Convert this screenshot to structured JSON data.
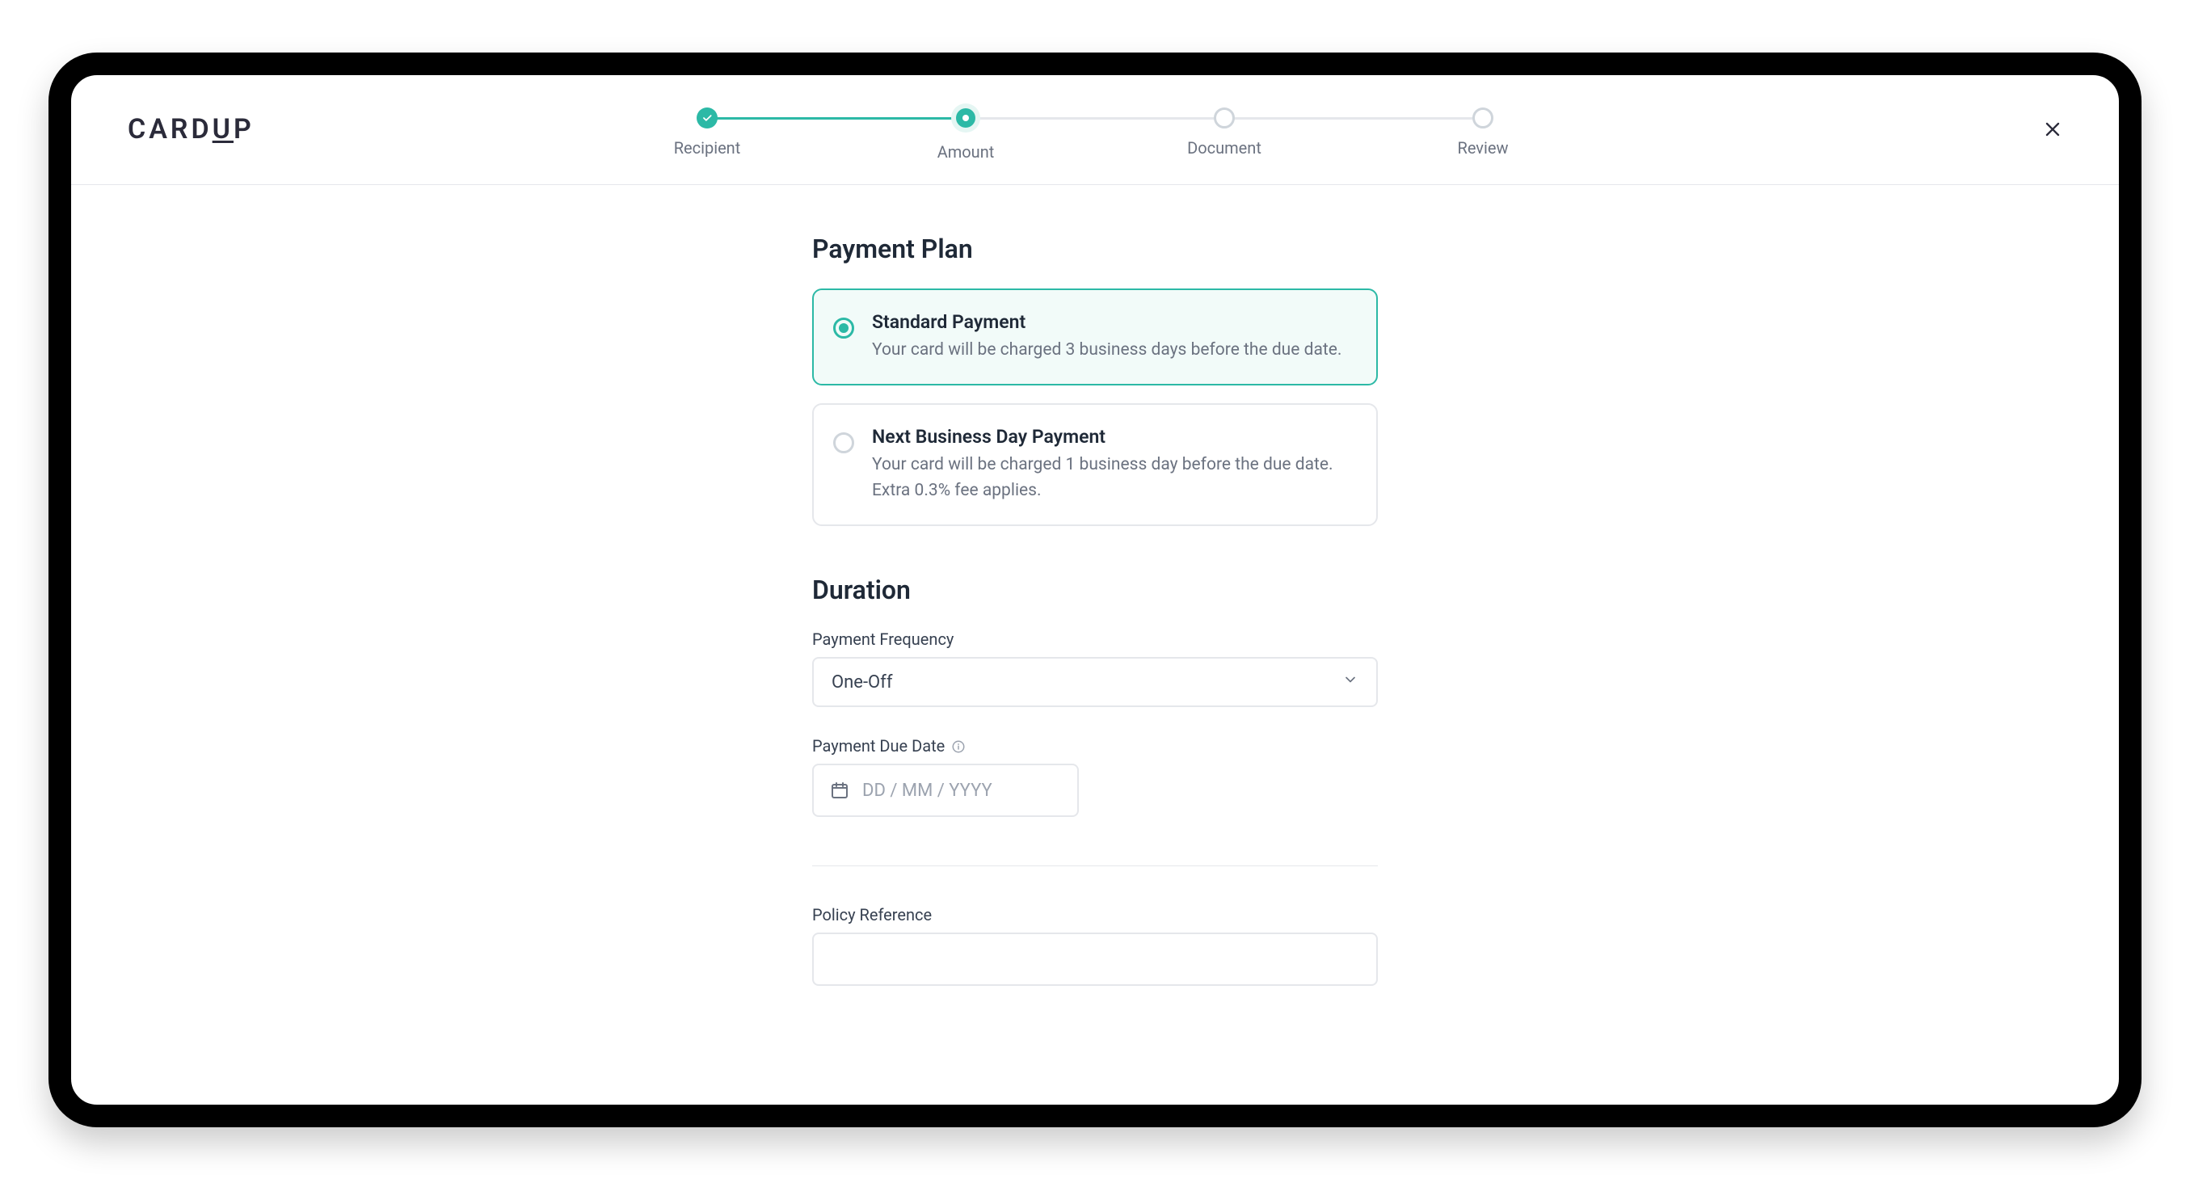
{
  "brand": "CARDUP",
  "stepper": {
    "steps": [
      {
        "label": "Recipient",
        "state": "completed"
      },
      {
        "label": "Amount",
        "state": "current"
      },
      {
        "label": "Document",
        "state": "upcoming"
      },
      {
        "label": "Review",
        "state": "upcoming"
      }
    ]
  },
  "payment_plan": {
    "title": "Payment Plan",
    "options": [
      {
        "title": "Standard Payment",
        "description": "Your card will be charged 3 business days before the due date.",
        "selected": true
      },
      {
        "title": "Next Business Day Payment",
        "description": "Your card will be charged 1 business day before the due date. Extra 0.3% fee applies.",
        "selected": false
      }
    ]
  },
  "duration": {
    "title": "Duration",
    "frequency_label": "Payment Frequency",
    "frequency_value": "One-Off",
    "due_date_label": "Payment Due Date",
    "due_date_placeholder": "DD / MM / YYYY",
    "due_date_value": ""
  },
  "policy": {
    "label": "Policy Reference",
    "value": ""
  }
}
